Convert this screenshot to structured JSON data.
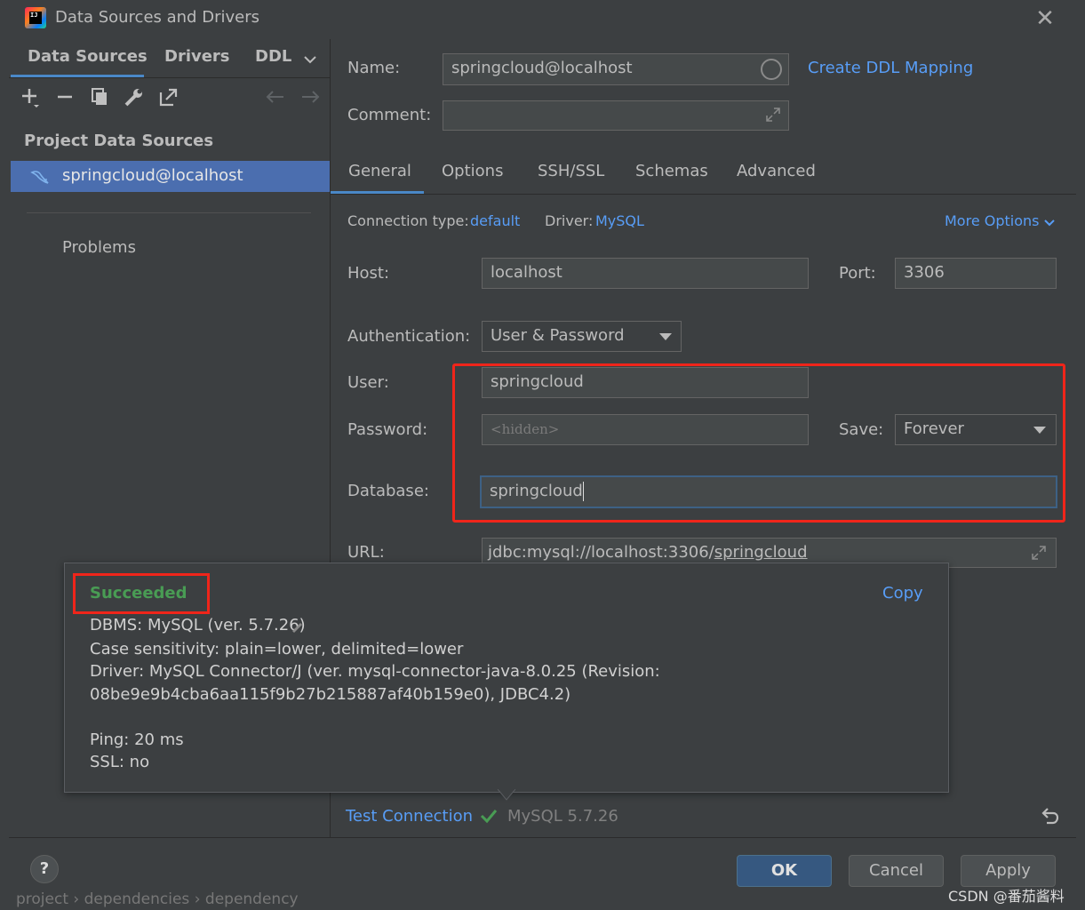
{
  "window": {
    "title": "Data Sources and Drivers",
    "close": "✕"
  },
  "left": {
    "tabs": [
      "Data Sources",
      "Drivers",
      "DDL"
    ],
    "section_title": "Project Data Sources",
    "items": [
      {
        "label": "springcloud@localhost"
      }
    ],
    "problems": "Problems"
  },
  "form": {
    "name_label": "Name:",
    "name_value": "springcloud@localhost",
    "create_ddl": "Create DDL Mapping",
    "comment_label": "Comment:",
    "comment_value": "",
    "tabs": [
      "General",
      "Options",
      "SSH/SSL",
      "Schemas",
      "Advanced"
    ],
    "conn_type_label": "Connection type:",
    "conn_type_value": "default",
    "driver_label": "Driver:",
    "driver_value": "MySQL",
    "more_options": "More Options",
    "host_label": "Host:",
    "host_value": "localhost",
    "port_label": "Port:",
    "port_value": "3306",
    "auth_label": "Authentication:",
    "auth_value": "User & Password",
    "user_label": "User:",
    "user_value": "springcloud",
    "password_label": "Password:",
    "password_placeholder": "<hidden>",
    "save_label": "Save:",
    "save_value": "Forever",
    "database_label": "Database:",
    "database_value": "springcloud",
    "url_label": "URL:",
    "url_prefix": "jdbc:mysql://localhost:3306/",
    "url_db": "springcloud"
  },
  "popup": {
    "status": "Succeeded",
    "copy": "Copy",
    "lines": [
      "DBMS: MySQL (ver. 5.7.26)",
      "Case sensitivity: plain=lower, delimited=lower",
      "Driver: MySQL Connector/J (ver. mysql-connector-java-8.0.25 (Revision:",
      "08be9e9b4cba6aa115f9b27b215887af40b159e0), JDBC4.2)",
      "Ping: 20 ms",
      "SSL: no"
    ]
  },
  "test": {
    "label": "Test Connection",
    "result": "MySQL 5.7.26"
  },
  "buttons": {
    "help": "?",
    "ok": "OK",
    "cancel": "Cancel",
    "apply": "Apply"
  },
  "background": {
    "breadcrumb": "project  ›  dependencies  ›  dependency"
  },
  "watermark": "CSDN @番茄酱料",
  "colors": {
    "accent": "#589df6",
    "selection": "#4b6eaf",
    "success": "#499c54",
    "highlight": "#f0251a"
  }
}
